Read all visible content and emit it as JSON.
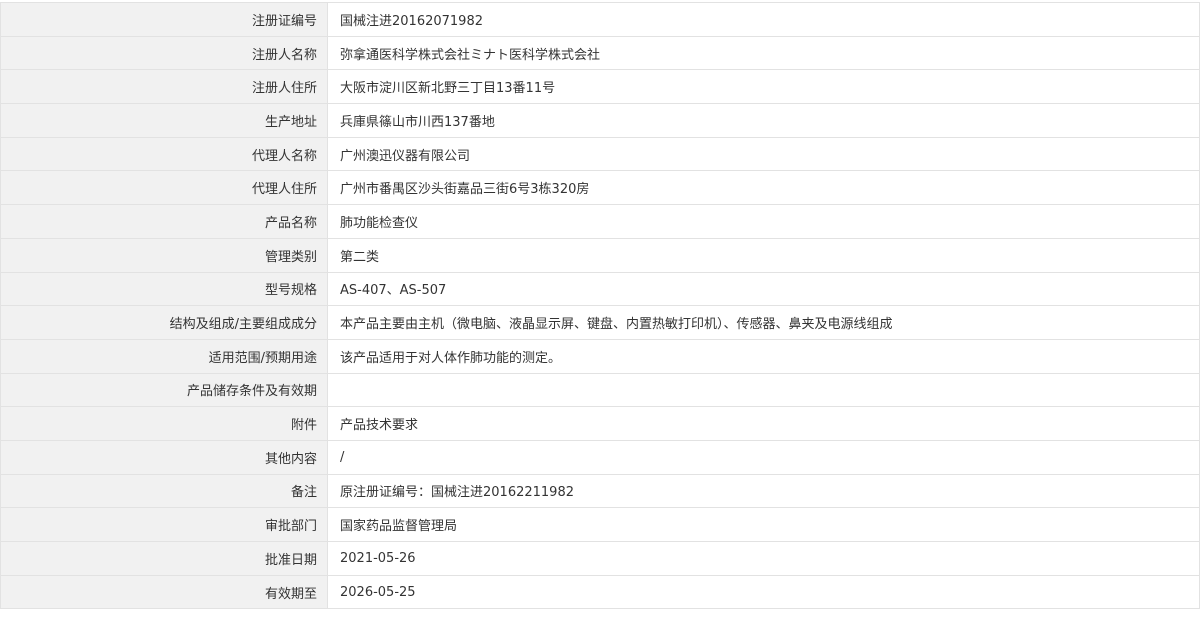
{
  "rows": [
    {
      "label": "注册证编号",
      "value": "国械注进20162071982"
    },
    {
      "label": "注册人名称",
      "value": "弥拿通医科学株式会社ミナト医科学株式会社"
    },
    {
      "label": "注册人住所",
      "value": "大阪市淀川区新北野三丁目13番11号"
    },
    {
      "label": "生产地址",
      "value": "兵庫県篠山市川西137番地"
    },
    {
      "label": "代理人名称",
      "value": "广州澳迅仪器有限公司"
    },
    {
      "label": "代理人住所",
      "value": "广州市番禺区沙头街嘉品三街6号3栋320房"
    },
    {
      "label": "产品名称",
      "value": "肺功能检查仪"
    },
    {
      "label": "管理类别",
      "value": "第二类"
    },
    {
      "label": "型号规格",
      "value": "AS-407、AS-507"
    },
    {
      "label": "结构及组成/主要组成成分",
      "value": "本产品主要由主机（微电脑、液晶显示屏、键盘、内置热敏打印机）、传感器、鼻夹及电源线组成"
    },
    {
      "label": "适用范围/预期用途",
      "value": "该产品适用于对人体作肺功能的测定。"
    },
    {
      "label": "产品储存条件及有效期",
      "value": ""
    },
    {
      "label": "附件",
      "value": "产品技术要求"
    },
    {
      "label": "其他内容",
      "value": "/"
    },
    {
      "label": "备注",
      "value": "原注册证编号：国械注进20162211982"
    },
    {
      "label": "审批部门",
      "value": "国家药品监督管理局"
    },
    {
      "label": "批准日期",
      "value": "2021-05-26"
    },
    {
      "label": "有效期至",
      "value": "2026-05-25"
    }
  ]
}
